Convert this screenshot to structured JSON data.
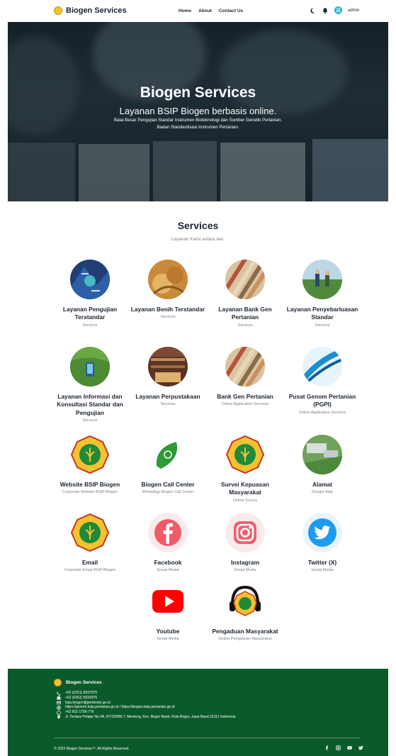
{
  "nav": {
    "brand": "Biogen Services",
    "links": [
      "Home",
      "About",
      "Contact Us"
    ],
    "user": "admin",
    "icons": [
      "moon-icon",
      "bell-icon",
      "user-icon"
    ]
  },
  "hero": {
    "title": "Biogen Services",
    "subtitle": "Layanan BSIP Biogen berbasis online.",
    "line1": "Balai Besar Pengujian Standar Instrumen Bioteknologi dan Sumber Genetik Pertanian.",
    "line2": "Badan Standardisasi Instrumen Pertanian."
  },
  "services": {
    "title": "Services",
    "subtitle": "Layanan Kami antara lain:",
    "items": [
      {
        "name": "Layanan Pengujian Terstandar",
        "desc": "Services",
        "image": "lab-photo"
      },
      {
        "name": "Layanan Benih Terstandar",
        "desc": "Services",
        "image": "seeds-photo"
      },
      {
        "name": "Layanan Bank Gen Pertanian",
        "desc": "Services",
        "image": "grain-rows-photo"
      },
      {
        "name": "Layanan Penyebarluasan Standar",
        "desc": "Services",
        "image": "field-people-photo"
      },
      {
        "name": "Layanan Informasi dan Konsultasi Standar dan Pengujian",
        "desc": "Services",
        "image": "phone-field-photo"
      },
      {
        "name": "Layanan Perpustakaan",
        "desc": "Services",
        "image": "library-photo"
      },
      {
        "name": "Bank Gen Pertanian",
        "desc": "Online Application Services",
        "image": "grain-rows-photo"
      },
      {
        "name": "Pusat Genom Pertanian (PGPI)",
        "desc": "Online Application Services",
        "image": "dna-photo"
      },
      {
        "name": "Website BSIP Biogen",
        "desc": "Corporate Website BSIP Biogen",
        "image": "emblem-logo"
      },
      {
        "name": "Biogen Call Center",
        "desc": "WhatsApp Biogen Call Center",
        "image": "whatsapp-leaf-icon"
      },
      {
        "name": "Survei Kepuasan Masyarakat",
        "desc": "Online Survey",
        "image": "emblem-logo"
      },
      {
        "name": "Alamat",
        "desc": "Google Map",
        "image": "building-aerial-photo"
      },
      {
        "name": "Email",
        "desc": "Corporate Email BSIP Biogen",
        "image": "emblem-logo"
      },
      {
        "name": "Facebook",
        "desc": "Sosial Media",
        "image": "facebook-icon"
      },
      {
        "name": "Instagram",
        "desc": "Sosial Media",
        "image": "instagram-icon"
      },
      {
        "name": "Twitter (X)",
        "desc": "Sosial Media",
        "image": "twitter-icon"
      },
      {
        "name": "Youtube",
        "desc": "Sosial Media",
        "image": "youtube-icon"
      },
      {
        "name": "Pengaduan Masyarakat",
        "desc": "Online Pengaduan Masyarakat",
        "image": "headset-emblem-icon"
      }
    ]
  },
  "footer": {
    "brand": "Biogen Services",
    "contacts": [
      {
        "icon": "phone-icon",
        "text": "+62 (0251) 8337975"
      },
      {
        "icon": "fax-icon",
        "text": "+62 (0251) 8333975"
      },
      {
        "icon": "mail-icon",
        "text": "bsip.biogen@pertanian.go.id"
      },
      {
        "icon": "globe-icon",
        "text": "https://genom.bsip.pertanian.go.id  /  https://biogen.bsip.pertanian.go.id"
      },
      {
        "icon": "whatsapp-icon",
        "text": "+62 811-1756-776"
      },
      {
        "icon": "location-icon",
        "text": "Jl. Tentara Pelajar No.3A, RT.02/RW.7, Menteng, Kec. Bogor Barat, Kota Bogor, Jawa Barat 16111 Indonesia"
      }
    ],
    "copyright": "© 2023 Biogen Services™. All Rights Reserved.",
    "social": [
      "facebook-icon",
      "instagram-icon",
      "youtube-icon",
      "twitter-icon"
    ]
  },
  "colors": {
    "footer_bg": "#0b5a29",
    "accent_blue": "#2bb3d9",
    "emblem_yellow": "#f2c230",
    "emblem_green": "#1e8a3a"
  }
}
